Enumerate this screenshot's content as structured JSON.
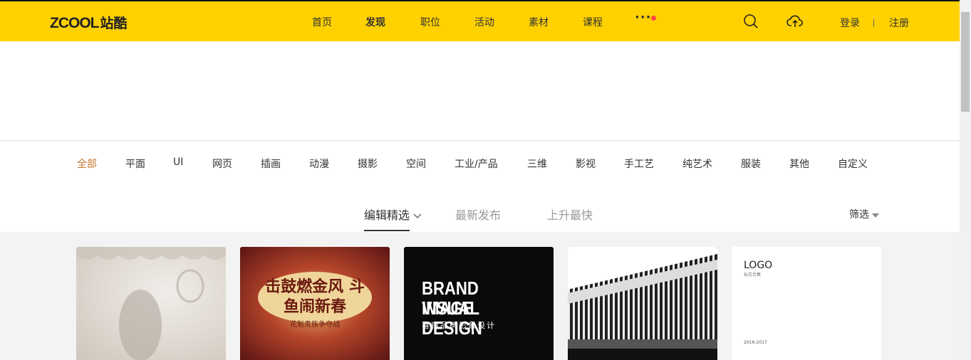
{
  "header": {
    "logo_text": "ZCOOL",
    "logo_cn": "站酷",
    "nav": [
      "首页",
      "发现",
      "职位",
      "活动",
      "素材",
      "课程"
    ],
    "more": "···",
    "login": "登录",
    "register": "注册"
  },
  "categories": [
    "全部",
    "平面",
    "UI",
    "网页",
    "插画",
    "动漫",
    "摄影",
    "空间",
    "工业/产品",
    "三维",
    "影视",
    "手工艺",
    "纯艺术",
    "服装",
    "其他",
    "自定义"
  ],
  "tabs": [
    "编辑精选",
    "最新发布",
    "上升最快"
  ],
  "filter": "筛选",
  "cards": [
    {
      "alt": "silhouette"
    },
    {
      "title": "击鼓燃金风 斗鱼闹新春",
      "sub": "花魁贵族争夺战"
    },
    {
      "line1": "BRAND VISUAL",
      "line2": "IMAGE DESIGN",
      "sub": "喜宿品牌形象设计"
    },
    {
      "alt": "building"
    },
    {
      "title": "LOGO",
      "sub": "标志合集",
      "year": "2016-2017"
    }
  ],
  "colors": {
    "brand": "#ffd100",
    "active": "#c5772d"
  }
}
